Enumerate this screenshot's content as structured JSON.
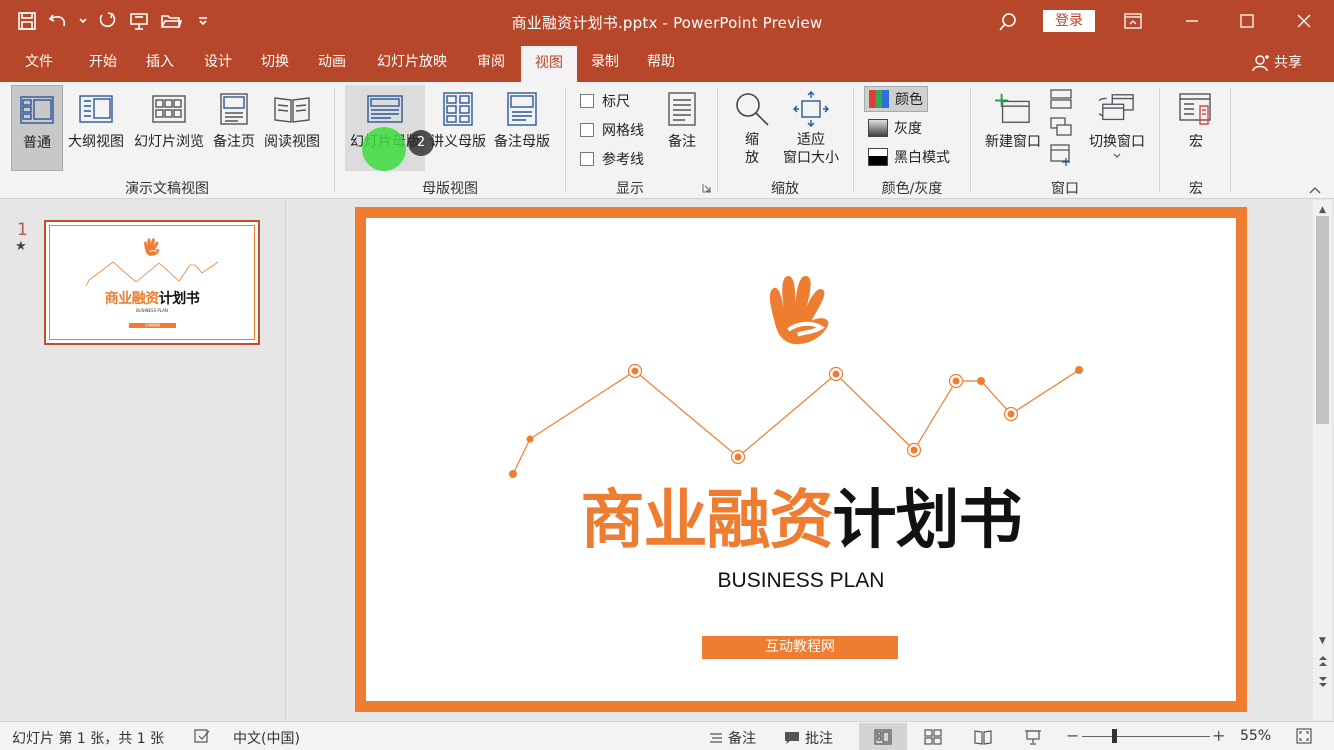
{
  "window": {
    "title": "商业融资计划书.pptx - PowerPoint Preview",
    "login_label": "登录"
  },
  "tabs": [
    {
      "label": "文件"
    },
    {
      "label": "开始"
    },
    {
      "label": "插入"
    },
    {
      "label": "设计"
    },
    {
      "label": "切换"
    },
    {
      "label": "动画"
    },
    {
      "label": "幻灯片放映"
    },
    {
      "label": "审阅"
    },
    {
      "label": "视图"
    },
    {
      "label": "录制"
    },
    {
      "label": "帮助"
    }
  ],
  "share_label": "共享",
  "ribbon": {
    "presentation_views": {
      "label": "演示文稿视图",
      "items": [
        "普通",
        "大纲视图",
        "幻灯片浏览",
        "备注页",
        "阅读视图"
      ]
    },
    "master_views": {
      "label": "母版视图",
      "items": [
        "幻灯片母版",
        "讲义母版",
        "备注母版"
      ],
      "badge": "2"
    },
    "show": {
      "label": "显示",
      "ruler": "标尺",
      "gridlines": "网格线",
      "guides": "参考线",
      "notes": "备注"
    },
    "zoom": {
      "label": "缩放",
      "zoom_line1": "缩",
      "zoom_line2": "放",
      "fit_line1": "适应",
      "fit_line2": "窗口大小"
    },
    "color": {
      "label": "颜色/灰度",
      "color": "颜色",
      "grayscale": "灰度",
      "bw": "黑白模式"
    },
    "window": {
      "label": "窗口",
      "new_window": "新建窗口",
      "switch_window": "切换窗口"
    },
    "macros": {
      "label": "宏",
      "macro": "宏"
    }
  },
  "thumbnails": [
    {
      "number": "1",
      "title_orange": "商业融资",
      "title_black": "计划书",
      "subtitle": "BUSINESS PLAN",
      "button": "互动教程网"
    }
  ],
  "slide": {
    "title_orange": "商业融资",
    "title_black": "计划书",
    "subtitle": "BUSINESS PLAN",
    "button": "互动教程网"
  },
  "statusbar": {
    "slide_info": "幻灯片 第 1 张，共 1 张",
    "language": "中文(中国)",
    "notes": "备注",
    "comments": "批注",
    "zoom": "55%"
  },
  "colors": {
    "accent": "#b7472a",
    "slide_orange": "#ee7d31"
  }
}
